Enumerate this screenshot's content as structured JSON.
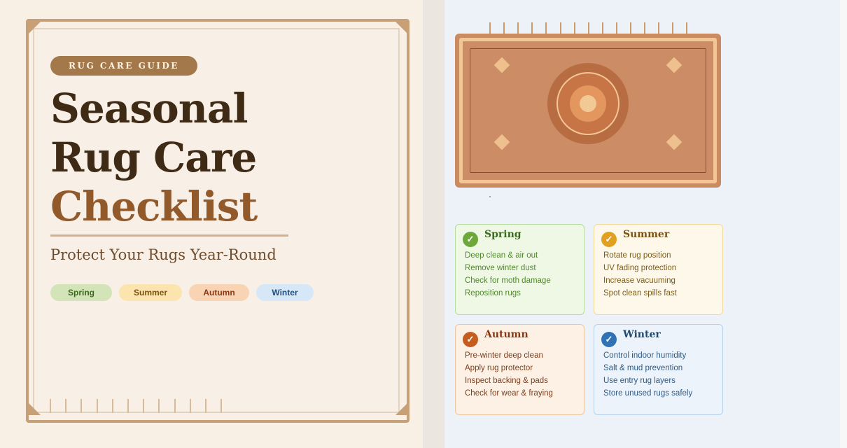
{
  "badge": "RUG CARE GUIDE",
  "title": {
    "line1": "Seasonal",
    "line2": "Rug Care",
    "line3": "Checklist"
  },
  "subtitle": "Protect Your Rugs Year-Round",
  "pills": [
    "Spring",
    "Summer",
    "Autumn",
    "Winter"
  ],
  "seasons": [
    {
      "name": "Spring",
      "check": "✓",
      "items": [
        "Deep clean & air out",
        "Remove winter dust",
        "Check for moth damage",
        "Reposition rugs"
      ]
    },
    {
      "name": "Summer",
      "check": "✓",
      "items": [
        "Rotate rug position",
        "UV fading protection",
        "Increase vacuuming",
        "Spot clean spills fast"
      ]
    },
    {
      "name": "Autumn",
      "check": "✓",
      "items": [
        "Pre-winter deep clean",
        "Apply rug protector",
        "Inspect backing & pads",
        "Check for wear & fraying"
      ]
    },
    {
      "name": "Winter",
      "check": "✓",
      "items": [
        "Control indoor humidity",
        "Salt & mud prevention",
        "Use entry rug layers",
        "Store unused rugs safely"
      ]
    }
  ],
  "colors": {
    "brand_brown": "#a3784a",
    "spring": "#6ea83a",
    "summer": "#e0a022",
    "autumn": "#c65d20",
    "winter": "#2f73b6"
  },
  "icons": {
    "rug": "rug-illustration-icon",
    "check": "checkmark-icon"
  }
}
